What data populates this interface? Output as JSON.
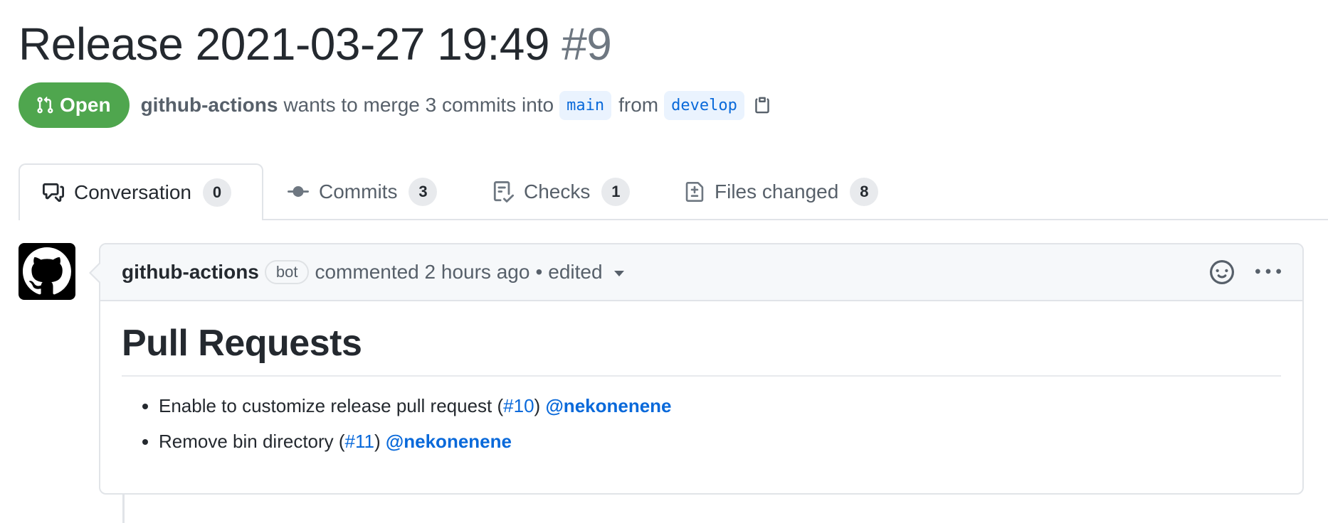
{
  "pr": {
    "title": "Release 2021-03-27 19:49",
    "number": "#9",
    "state": "Open",
    "state_icon": "git-pull-request-icon",
    "author": "github-actions",
    "summary_pre": "wants to merge 3 commits into",
    "base_branch": "main",
    "from_label": "from",
    "head_branch": "develop",
    "copy_icon": "clipboard-icon"
  },
  "colors": {
    "open_green": "#4fa64e",
    "link_blue": "#0969da"
  },
  "tabs": [
    {
      "label": "Conversation",
      "count": "0",
      "icon": "comment-discussion-icon",
      "active": true
    },
    {
      "label": "Commits",
      "count": "3",
      "icon": "git-commit-icon",
      "active": false
    },
    {
      "label": "Checks",
      "count": "1",
      "icon": "checklist-icon",
      "active": false
    },
    {
      "label": "Files changed",
      "count": "8",
      "icon": "file-diff-icon",
      "active": false
    }
  ],
  "comment": {
    "author": "github-actions",
    "badge": "bot",
    "meta": "commented 2 hours ago",
    "separator": "•",
    "edited": "edited",
    "heading": "Pull Requests",
    "items": [
      {
        "text": "Enable to customize release pull request (",
        "link": "#10",
        "after": ")",
        "mention": "@nekonenene"
      },
      {
        "text": "Remove bin directory (",
        "link": "#11",
        "after": ")",
        "mention": "@nekonenene"
      }
    ]
  }
}
